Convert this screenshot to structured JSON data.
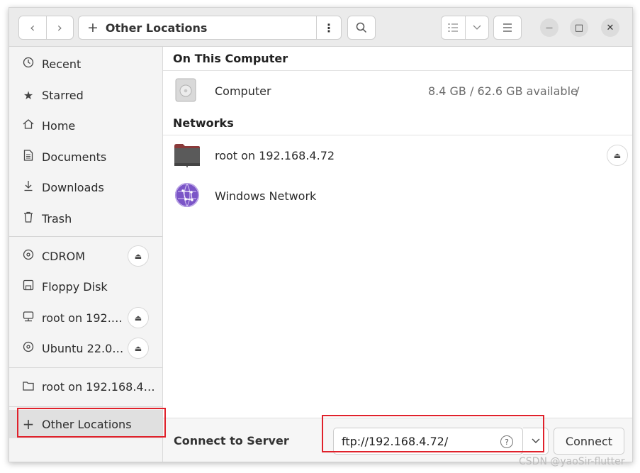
{
  "titlebar": {
    "back_icon": "chevron-left-icon",
    "forward_icon": "chevron-right-icon",
    "location": "Other Locations",
    "location_icon": "plus-icon",
    "path_menu": "⋮",
    "search_icon": "search-icon",
    "view_list_icon": "list-view-icon",
    "view_options_icon": "chevron-down-icon",
    "main_menu_icon": "hamburger-menu-icon",
    "minimize": "—",
    "maximize": "□",
    "close": "✕"
  },
  "sidebar": {
    "items": [
      {
        "label": "Recent",
        "icon": "🕔"
      },
      {
        "label": "Starred",
        "icon": "★"
      },
      {
        "label": "Home",
        "icon": "⌂"
      },
      {
        "label": "Documents",
        "icon": "▤"
      },
      {
        "label": "Downloads",
        "icon": "⤓"
      },
      {
        "label": "Trash",
        "icon": "🗑"
      },
      {
        "label": "CDROM",
        "icon": "◎"
      },
      {
        "label": "Floppy Disk",
        "icon": "▭"
      },
      {
        "label": "root on 192.…",
        "icon": "▢"
      },
      {
        "label": "Ubuntu 22.0…",
        "icon": "◎"
      },
      {
        "label": "root on 192.168.4…",
        "icon": "▭"
      },
      {
        "label": "Other Locations",
        "icon": "+"
      }
    ],
    "eject_icon": "⏏"
  },
  "main": {
    "on_this_computer": "On This Computer",
    "computer": {
      "name": "Computer",
      "space": "8.4 GB / 62.6 GB available",
      "mount": "/"
    },
    "networks": "Networks",
    "network_items": [
      {
        "name": "root on 192.168.4.72"
      },
      {
        "name": "Windows Network"
      }
    ]
  },
  "bottom": {
    "connect_label": "Connect to Server",
    "server_value": "ftp://192.168.4.72/",
    "help_icon": "?",
    "dropdown_icon": "⌄",
    "connect_button": "Connect"
  },
  "watermark": "CSDN @yaoSir-flutter",
  "colors": {
    "highlight": "#e0212b",
    "accent_network": "#7b55c7",
    "folder": "#8a3a3a"
  }
}
